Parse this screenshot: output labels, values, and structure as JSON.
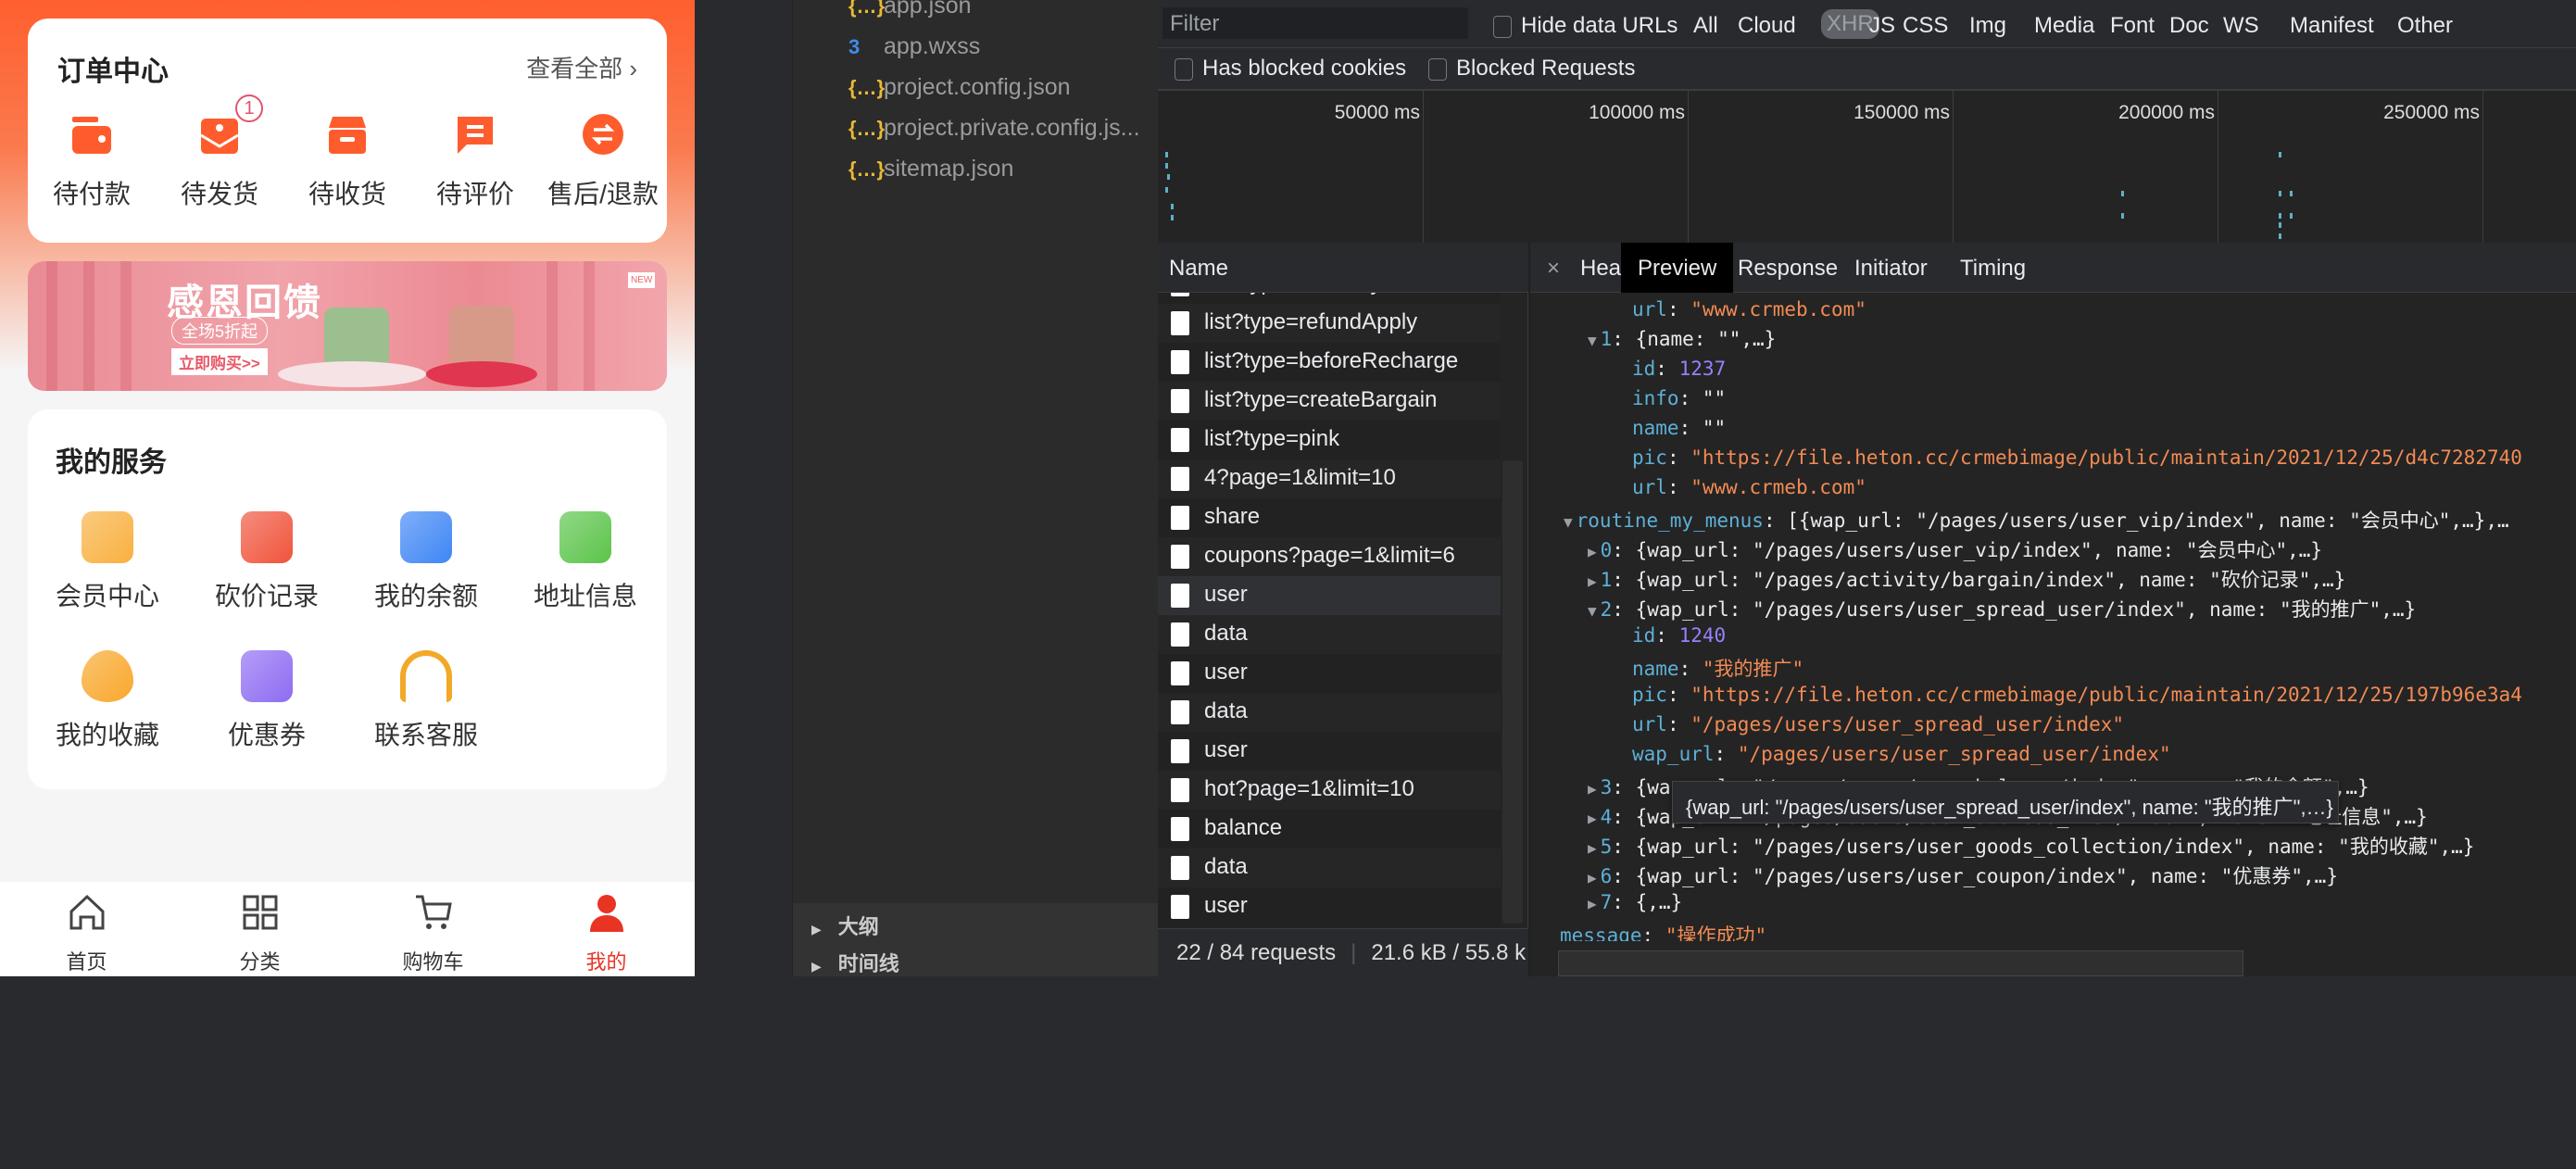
{
  "phone": {
    "order_center": {
      "title": "订单中心",
      "view_all": "查看全部",
      "items": [
        {
          "label": "待付款",
          "icon": "wallet-icon"
        },
        {
          "label": "待发货",
          "icon": "package-heart-icon",
          "badge": "1"
        },
        {
          "label": "待收货",
          "icon": "box-icon"
        },
        {
          "label": "待评价",
          "icon": "comment-icon"
        },
        {
          "label": "售后/退款",
          "icon": "exchange-icon"
        }
      ]
    },
    "banner": {
      "title": "感恩回馈",
      "subtitle": "全场5折起",
      "button": "立即购买>>",
      "tag": "NEW"
    },
    "services": {
      "title": "我的服务",
      "items": [
        {
          "label": "会员中心",
          "icon": "vip-diamond-icon",
          "color": "#f9b040"
        },
        {
          "label": "砍价记录",
          "icon": "bargain-card-icon",
          "color": "#f0543c"
        },
        {
          "label": "我的余额",
          "icon": "balance-wallet-icon",
          "color": "#3f86f5"
        },
        {
          "label": "地址信息",
          "icon": "building-icon",
          "color": "#5bc44a"
        },
        {
          "label": "我的收藏",
          "icon": "heart-icon",
          "color": "#f9a72b"
        },
        {
          "label": "优惠券",
          "icon": "coupon-icon",
          "color": "#8e6cf2"
        },
        {
          "label": "联系客服",
          "icon": "headset-icon",
          "color": "#f2a927"
        }
      ]
    },
    "tabbar": [
      {
        "label": "首页",
        "icon": "home-icon"
      },
      {
        "label": "分类",
        "icon": "grid-icon"
      },
      {
        "label": "购物车",
        "icon": "cart-icon"
      },
      {
        "label": "我的",
        "icon": "user-icon",
        "active": true
      }
    ],
    "accent": "#e93323"
  },
  "sidebar": {
    "files": [
      {
        "name": "app.json",
        "type": "json"
      },
      {
        "name": "app.wxss",
        "type": "css"
      },
      {
        "name": "project.config.json",
        "type": "json"
      },
      {
        "name": "project.private.config.js...",
        "type": "json"
      },
      {
        "name": "sitemap.json",
        "type": "json"
      }
    ],
    "outline": [
      "大纲",
      "时间线"
    ]
  },
  "devtools": {
    "filter_placeholder": "Filter",
    "hide_data_urls": "Hide data URLs",
    "types": [
      "All",
      "Cloud",
      "XHR",
      "JS",
      "CSS",
      "Img",
      "Media",
      "Font",
      "Doc",
      "WS",
      "Manifest",
      "Other"
    ],
    "active_type": "XHR",
    "has_blocked_cookies": "Has blocked cookies",
    "blocked_requests": "Blocked Requests",
    "timeline_ticks": [
      "50000 ms",
      "100000 ms",
      "150000 ms",
      "200000 ms",
      "250000 ms"
    ],
    "name_header": "Name",
    "requests": [
      "list?type=afterPay",
      "list?type=refundApply",
      "list?type=beforeRecharge",
      "list?type=createBargain",
      "list?type=pink",
      "4?page=1&limit=10",
      "share",
      "coupons?page=1&limit=6",
      "user",
      "data",
      "user",
      "data",
      "user",
      "hot?page=1&limit=10",
      "balance",
      "data",
      "user"
    ],
    "status_requests": "22 / 84 requests",
    "status_size": "21.6 kB / 55.8 k",
    "tabs": [
      "Headers",
      "Preview",
      "Response",
      "Initiator",
      "Timing"
    ],
    "active_tab": "Preview",
    "preview": {
      "lines": [
        {
          "indent": 3,
          "key": "url",
          "val": "\"www.crmeb.com\"",
          "t": "s"
        },
        {
          "indent": 2,
          "tri": "▼",
          "key": "1",
          "val": "{name: \"\",…}",
          "t": "w"
        },
        {
          "indent": 3,
          "key": "id",
          "val": "1237",
          "t": "n"
        },
        {
          "indent": 3,
          "key": "info",
          "val": "\"\"",
          "t": "w"
        },
        {
          "indent": 3,
          "key": "name",
          "val": "\"\"",
          "t": "w"
        },
        {
          "indent": 3,
          "key": "pic",
          "val": "\"https://file.heton.cc/crmebimage/public/maintain/2021/12/25/d4c7282740",
          "t": "s"
        },
        {
          "indent": 3,
          "key": "url",
          "val": "\"www.crmeb.com\"",
          "t": "s"
        },
        {
          "indent": 1,
          "tri": "▼",
          "key": "routine_my_menus",
          "val": "[{wap_url: \"/pages/users/user_vip/index\", name: \"会员中心\",…},…",
          "t": "w"
        },
        {
          "indent": 2,
          "tri": "▶",
          "key": "0",
          "val": "{wap_url: \"/pages/users/user_vip/index\", name: \"会员中心\",…}",
          "t": "w"
        },
        {
          "indent": 2,
          "tri": "▶",
          "key": "1",
          "val": "{wap_url: \"/pages/activity/bargain/index\", name: \"砍价记录\",…}",
          "t": "w"
        },
        {
          "indent": 2,
          "tri": "▼",
          "key": "2",
          "val": "{wap_url: \"/pages/users/user_spread_user/index\", name: \"我的推广\",…}",
          "t": "w"
        },
        {
          "indent": 3,
          "key": "id",
          "val": "1240",
          "t": "n"
        },
        {
          "indent": 3,
          "key": "name",
          "val": "\"我的推广\"",
          "t": "s"
        },
        {
          "indent": 3,
          "key": "pic",
          "val": "\"https://file.heton.cc/crmebimage/public/maintain/2021/12/25/197b96e3a4",
          "t": "s"
        },
        {
          "indent": 3,
          "key": "url",
          "val": "\"/pages/users/user_spread_user/index\"",
          "t": "s"
        },
        {
          "indent": 3,
          "key": "wap_url",
          "val": "\"/pages/users/user_spread_user/index\"",
          "t": "s"
        },
        {
          "indent": 2,
          "tri": "▶",
          "key": "3",
          "val": "{wap_url: \"/pages/users/user_balance/index\", name: \"我的余额\",…}",
          "t": "w"
        },
        {
          "indent": 2,
          "tri": "▶",
          "key": "4",
          "val": "{wap_url: \"/pages/users/user_address_list/index\", name: \"地址信息\",…}",
          "t": "w"
        },
        {
          "indent": 2,
          "tri": "▶",
          "key": "5",
          "val": "{wap_url: \"/pages/users/user_goods_collection/index\", name: \"我的收藏\",…}",
          "t": "w"
        },
        {
          "indent": 2,
          "tri": "▶",
          "key": "6",
          "val": "{wap_url: \"/pages/users/user_coupon/index\", name: \"优惠券\",…}",
          "t": "w"
        },
        {
          "indent": 2,
          "tri": "▶",
          "key": "7",
          "val": "{,…}",
          "t": "w"
        },
        {
          "indent": 0,
          "key": "message",
          "val": "\"操作成功\"",
          "t": "s"
        }
      ],
      "tooltip": "{wap_url: \"/pages/users/user_spread_user/index\", name: \"我的推广\",…}"
    }
  }
}
